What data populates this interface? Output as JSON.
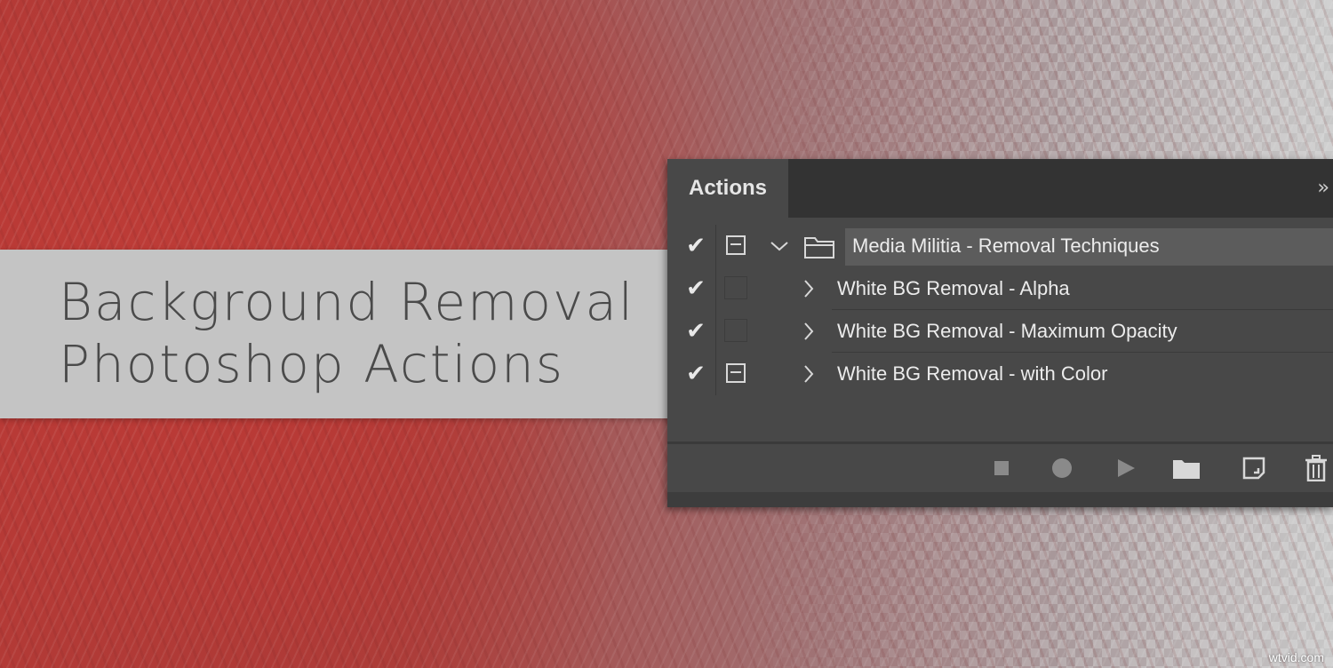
{
  "banner": {
    "line1": "Background Removal",
    "line2": "Photoshop Actions"
  },
  "panel": {
    "tab_label": "Actions",
    "collapse_glyph": "»",
    "rows": [
      {
        "type": "set",
        "check": "✔",
        "dialog": "on",
        "label": "Media Militia - Removal Techniques",
        "expanded": true
      },
      {
        "type": "action",
        "check": "✔",
        "dialog": "off",
        "label": "White BG Removal - Alpha"
      },
      {
        "type": "action",
        "check": "✔",
        "dialog": "off",
        "label": "White BG Removal - Maximum Opacity"
      },
      {
        "type": "action",
        "check": "✔",
        "dialog": "on",
        "label": "White BG Removal - with Color"
      }
    ],
    "footer_tools": [
      "stop-icon",
      "record-icon",
      "play-icon",
      "folder-icon",
      "new-action-icon",
      "trash-icon"
    ],
    "icon_color": "#d8d8d8"
  },
  "watermark": "wtvid.com",
  "colors": {
    "background_red": "#b33a36",
    "banner_grey": "#c4c4c4",
    "panel_bg": "#484848",
    "panel_header": "#333333"
  }
}
